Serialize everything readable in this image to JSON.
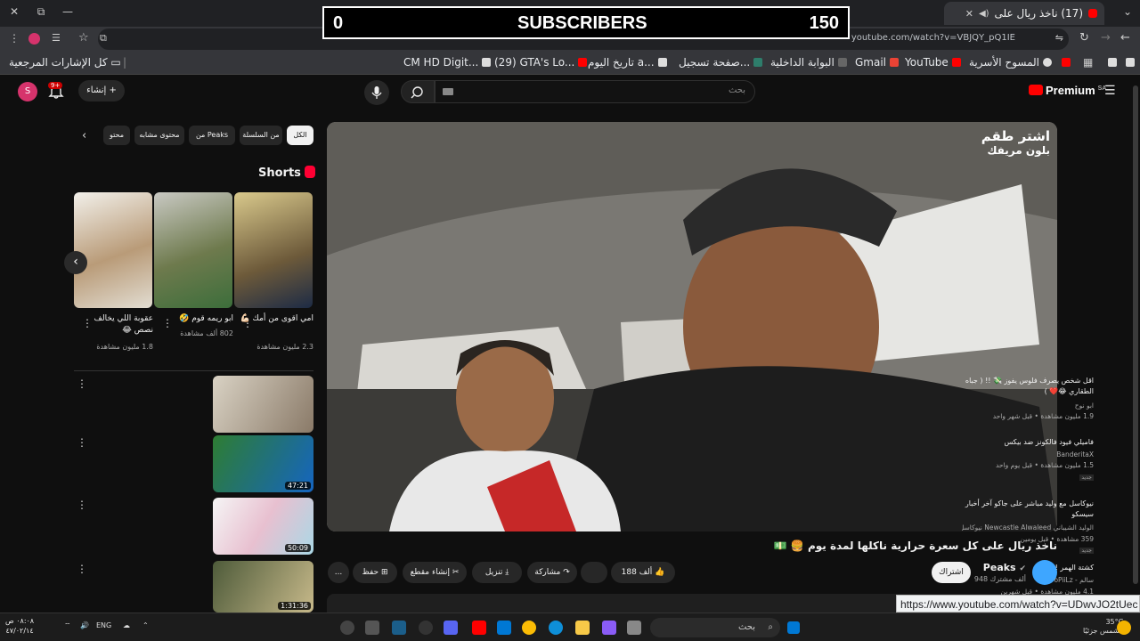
{
  "browser": {
    "tab_title": "(17) ناخذ ريال على",
    "url": "youtube.com/watch?v=VBJQY_pQ1IE",
    "bookmarks": [
      "كل الإشارات المرجعية",
      "CM HD Digit...",
      "(29) GTA's Lo...",
      "تاريخ اليوم a...",
      "صفحة تسجيل...",
      "البوابة الداخلية",
      "Gmail",
      "YouTube",
      "المسوح الأسرية"
    ]
  },
  "overlay": {
    "left_value": "0",
    "label": "SUBSCRIBERS",
    "right_value": "150"
  },
  "youtube": {
    "logo": "Premium",
    "logo_region": "SA",
    "search_placeholder": "بحث",
    "create_label": "إنشاء",
    "notifications_badge": "9+",
    "avatar_letter": "S"
  },
  "video": {
    "watermark_line1": "اشتر طقم",
    "watermark_line2": "بلون مريفك",
    "title": "ناخذ ريال على كل سعرة حرارية ناكلها لمدة يوم 🍔 💵",
    "channel": "Peaks",
    "subscribers": "948 ألف مشترك",
    "subscribe_label": "اشتراك",
    "likes": "188 ألف",
    "share_label": "مشاركة",
    "download_label": "تنزيل",
    "clip_label": "إنشاء مقطع",
    "save_label": "حفظ",
    "more_label": "..."
  },
  "chips": [
    "الكل",
    "من السلسلة",
    "من Peaks",
    "محتوى مشابه",
    "محتو"
  ],
  "shorts": {
    "heading": "Shorts",
    "items": [
      {
        "title": "امي اقوى من أمك 💪🏻",
        "views": "2.3 مليون مشاهدة"
      },
      {
        "title": "ابو ريمه قوم 🤣",
        "views": "802 ألف مشاهدة"
      },
      {
        "title": "عقوبة اللي يخالف نصص 😂",
        "views": "1.8 مليون مشاهدة"
      }
    ]
  },
  "recommended": [
    {
      "title": "اقل شخص يصرف فلوس يفوز 💸 !! ( جباه الطقاري 😂❤️ )",
      "channel": "ابو نوح",
      "meta": "1.9 مليون مشاهدة • قبل شهر واحد",
      "duration": "",
      "is_new": ""
    },
    {
      "title": "فاميلي فيود فالكونز ضد بيكس",
      "channel": "BanderitaX",
      "meta": "1.5 مليون مشاهدة • قبل يوم واحد",
      "duration": "47:21",
      "is_new": "جديد"
    },
    {
      "title": "نيوكاسل مع وليد مباشر على جاكو آخر أخبار سيسكو",
      "channel": "الوليد الشيباني Newcastle Alwaleed نيوكاسل مع و...",
      "meta": "359 مشاهدة • قبل يومين",
      "duration": "50:09",
      "is_new": "جديد"
    },
    {
      "title": "كشتة الهمر !",
      "channel": "سالم - oPiiLz",
      "meta": "4.1 مليون مشاهدة • قبل شهرين",
      "duration": "1:31:36",
      "is_new": ""
    }
  ],
  "status_url": "https://www.youtube.com/watch?v=UDwvJO2tUec",
  "taskbar": {
    "search_label": "بحث",
    "language": "ENG",
    "time": "٠٨:٠٨ ص",
    "date": "٤٧/٠٢/١٤",
    "weather_temp": "35°C",
    "weather_desc": "مشمس جزئيًا"
  }
}
